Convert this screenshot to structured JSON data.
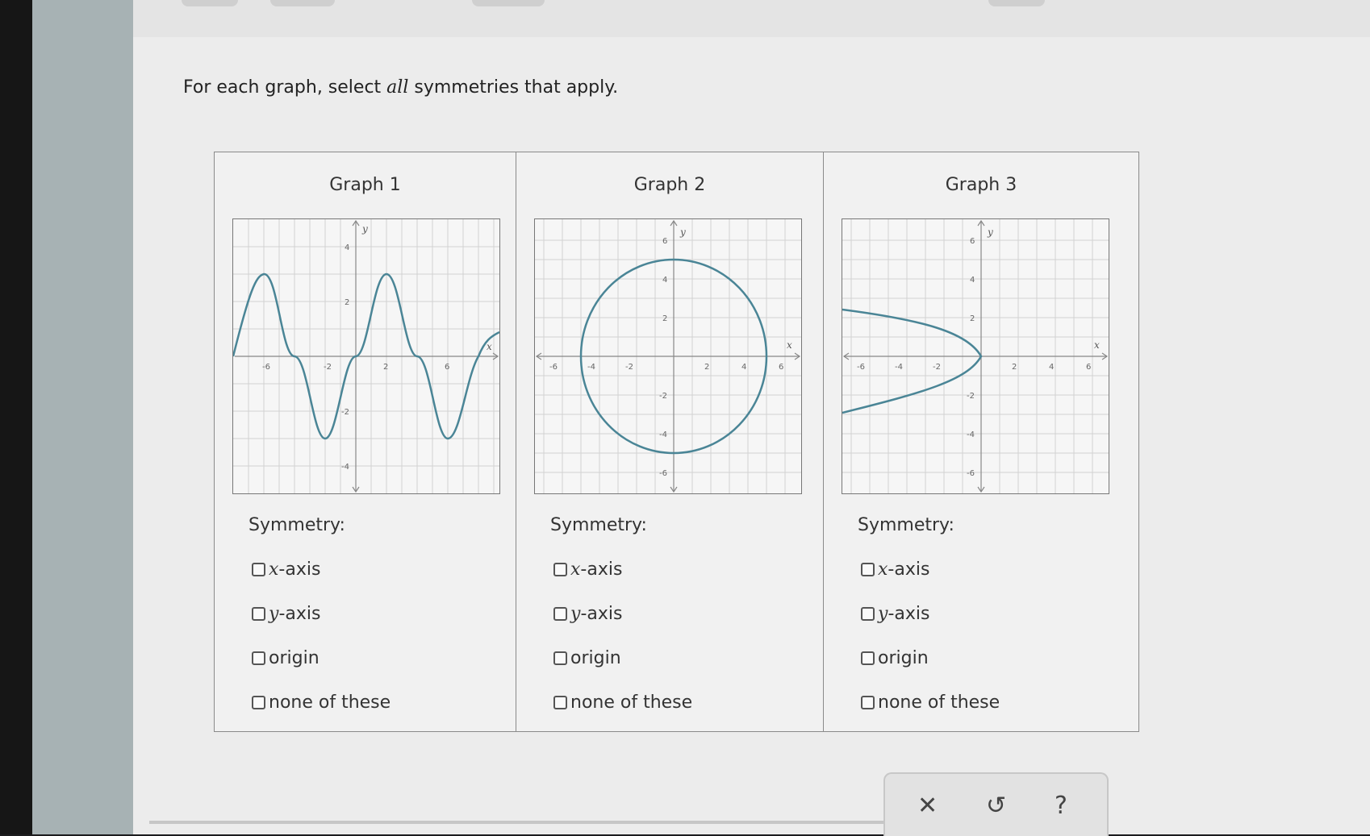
{
  "instruction": {
    "prefix": "For each graph, select ",
    "emph": "all",
    "suffix": " symmetries that apply."
  },
  "graphs": [
    {
      "title": "Graph 1",
      "xticks": [
        "-6",
        "-2",
        "2",
        "6"
      ],
      "yticks": [
        "4",
        "2",
        "-2",
        "-4"
      ],
      "xlabel": "x",
      "ylabel": "y",
      "curve": "sine",
      "symmetry_label": "Symmetry:",
      "options": [
        {
          "var": "x",
          "label": "-axis"
        },
        {
          "var": "y",
          "label": "-axis"
        },
        {
          "var": "",
          "label": "origin"
        },
        {
          "var": "",
          "label": "none of these"
        }
      ]
    },
    {
      "title": "Graph 2",
      "xticks": [
        "-6",
        "-4",
        "-2",
        "2",
        "4",
        "6"
      ],
      "yticks": [
        "6",
        "4",
        "2",
        "-2",
        "-4",
        "-6"
      ],
      "xlabel": "x",
      "ylabel": "y",
      "curve": "circle",
      "symmetry_label": "Symmetry:",
      "options": [
        {
          "var": "x",
          "label": "-axis"
        },
        {
          "var": "y",
          "label": "-axis"
        },
        {
          "var": "",
          "label": "origin"
        },
        {
          "var": "",
          "label": "none of these"
        }
      ]
    },
    {
      "title": "Graph 3",
      "xticks": [
        "-6",
        "-4",
        "-2",
        "2",
        "4",
        "6"
      ],
      "yticks": [
        "6",
        "4",
        "2",
        "-2",
        "-4",
        "-6"
      ],
      "xlabel": "x",
      "ylabel": "y",
      "curve": "parabola-left",
      "symmetry_label": "Symmetry:",
      "options": [
        {
          "var": "x",
          "label": "-axis"
        },
        {
          "var": "y",
          "label": "-axis"
        },
        {
          "var": "",
          "label": "origin"
        },
        {
          "var": "",
          "label": "none of these"
        }
      ]
    }
  ],
  "actions": {
    "clear": "✕",
    "undo": "↺",
    "help": "?"
  },
  "colors": {
    "curve": "#4a8596",
    "grid": "#d2d2d2",
    "axis": "#888888"
  }
}
